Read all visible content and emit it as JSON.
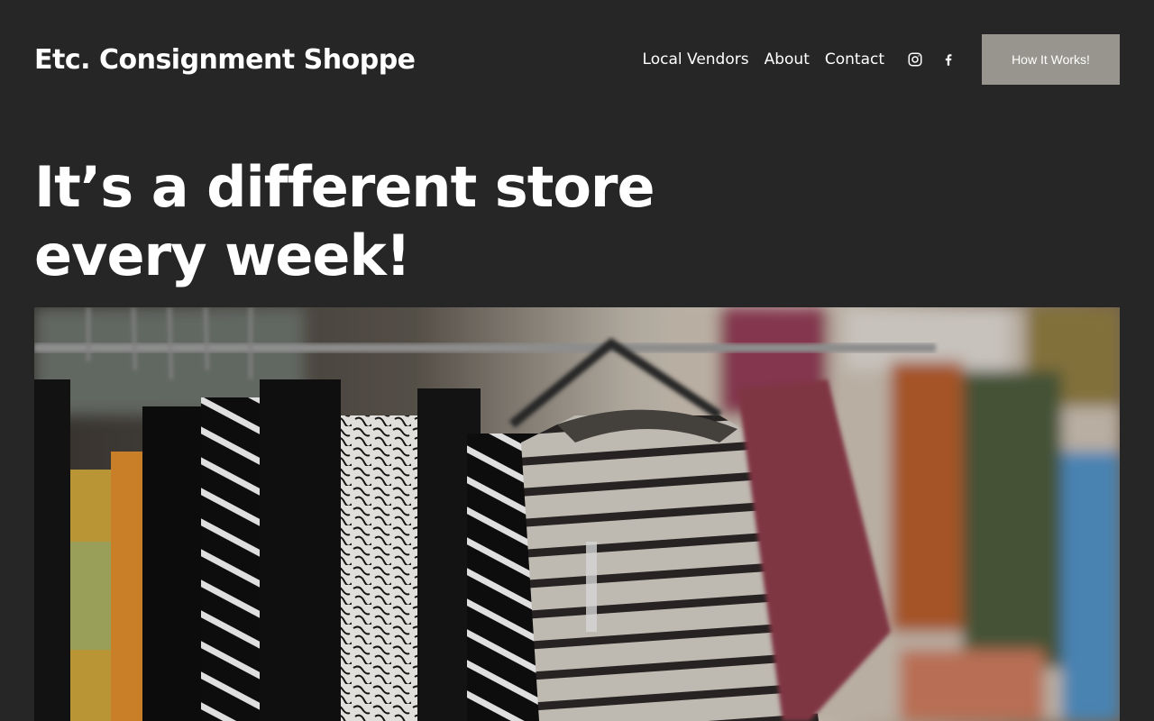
{
  "site": {
    "title": "Etc. Consignment Shoppe"
  },
  "nav": {
    "items": [
      {
        "label": "Local Vendors"
      },
      {
        "label": "About"
      },
      {
        "label": "Contact"
      }
    ]
  },
  "social": {
    "icons": [
      "instagram-icon",
      "facebook-icon"
    ]
  },
  "cta": {
    "label": "How It Works!",
    "color": "#97958d"
  },
  "hero": {
    "heading": "It’s a different store every week!"
  },
  "colors": {
    "background": "#262626",
    "text": "#ffffff"
  }
}
